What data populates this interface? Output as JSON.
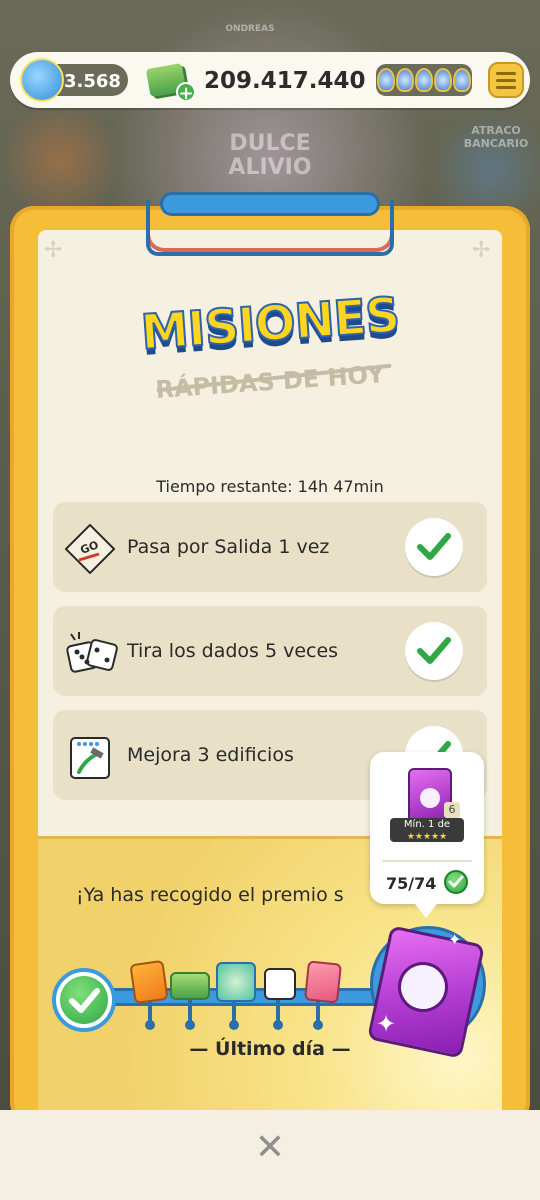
{
  "background": {
    "board_label_1": "DULCE ALIVIO",
    "board_label_2": "ATRACO BANCARIO",
    "board_label_3": "ONDREAS"
  },
  "topbar": {
    "level": "3.568",
    "cash": "209.417.440"
  },
  "title": {
    "main": "MISIONES",
    "sub": "RÁPIDAS DE HOY"
  },
  "timer": "Tiempo restante: 14h 47min",
  "missions": [
    {
      "label": "Pasa por Salida 1 vez",
      "icon": "go-tile-icon",
      "icon_text": "GO",
      "done": true
    },
    {
      "label": "Tira los dados 5 veces",
      "icon": "dice-icon",
      "done": true
    },
    {
      "label": "Mejora 3 edificios",
      "icon": "hammer-icon",
      "done": true
    }
  ],
  "progress": {
    "collected_text": "¡Ya has recogido el premio s",
    "last_day": "— Último día —"
  },
  "tooltip": {
    "min_text": "Mín. 1 de",
    "stars": "★★★★★",
    "count": "6",
    "progress": "75/74"
  },
  "close_label": "✕",
  "colors": {
    "accent_yellow": "#f5bd3a",
    "accent_blue": "#3c9adf",
    "check_green": "#2fa744",
    "paper": "#f5f0df"
  }
}
